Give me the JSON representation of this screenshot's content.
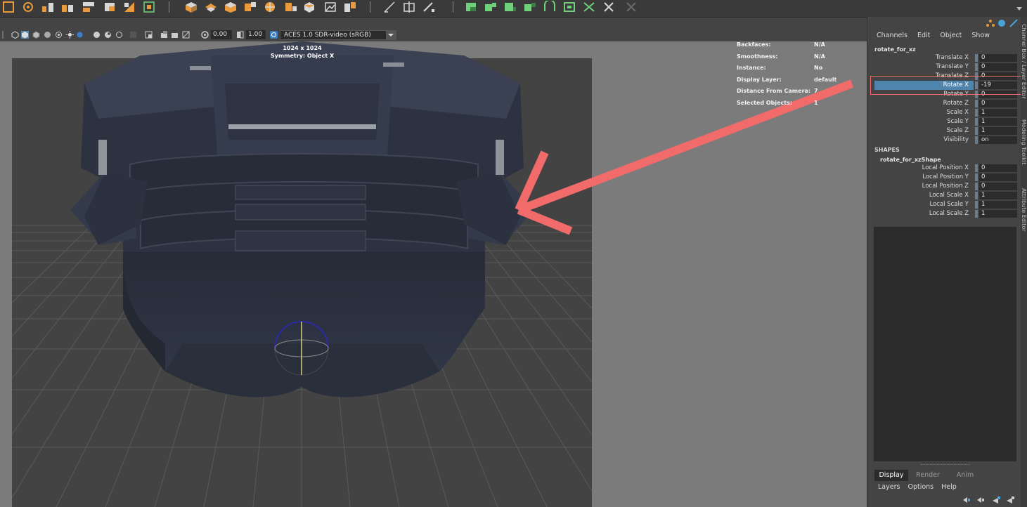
{
  "viewport_toolbar": {
    "exposure_value": "0.00",
    "gamma_value": "1.00",
    "color_space": "ACES 1.0 SDR-video (sRGB)"
  },
  "viewport": {
    "resolution_gate": "1024 x 1024",
    "symmetry": "Symmetry: Object X",
    "hud": [
      {
        "label": "Backfaces:",
        "value": "N/A"
      },
      {
        "label": "Smoothness:",
        "value": "N/A"
      },
      {
        "label": "Instance:",
        "value": "No"
      },
      {
        "label": "Display Layer:",
        "value": "default"
      },
      {
        "label": "Distance From Camera:",
        "value": "7"
      },
      {
        "label": "Selected Objects:",
        "value": "1"
      }
    ]
  },
  "channel_box": {
    "menus": [
      "Channels",
      "Edit",
      "Object",
      "Show"
    ],
    "node_name": "rotate_for_xz",
    "channels": [
      {
        "label": "Translate X",
        "value": "0"
      },
      {
        "label": "Translate Y",
        "value": "0"
      },
      {
        "label": "Translate Z",
        "value": "0"
      },
      {
        "label": "Rotate X",
        "value": "-19"
      },
      {
        "label": "Rotate Y",
        "value": "0"
      },
      {
        "label": "Rotate Z",
        "value": "0"
      },
      {
        "label": "Scale X",
        "value": "1"
      },
      {
        "label": "Scale Y",
        "value": "1"
      },
      {
        "label": "Scale Z",
        "value": "1"
      },
      {
        "label": "Visibility",
        "value": "on"
      }
    ],
    "selected_channel": "Rotate X",
    "shapes_title": "SHAPES",
    "shape_name": "rotate_for_xzShape",
    "shape_channels": [
      {
        "label": "Local Position X",
        "value": "0"
      },
      {
        "label": "Local Position Y",
        "value": "0"
      },
      {
        "label": "Local Position Z",
        "value": "0"
      },
      {
        "label": "Local Scale X",
        "value": "1"
      },
      {
        "label": "Local Scale Y",
        "value": "1"
      },
      {
        "label": "Local Scale Z",
        "value": "1"
      }
    ]
  },
  "side_tabs": [
    "Channel Box / Layer Editor",
    "Modeling Toolkit",
    "Attribute Editor"
  ],
  "layer_editor": {
    "tabs": [
      "Display",
      "Render",
      "Anim"
    ],
    "active_tab": "Display",
    "menus": [
      "Layers",
      "Options",
      "Help"
    ]
  },
  "colors": {
    "highlight": "#f26b6b",
    "selection": "#4f85ad",
    "shelf_orange": "#e89a3c",
    "shelf_green": "#6fd17a",
    "mesh": "#2e3442"
  }
}
